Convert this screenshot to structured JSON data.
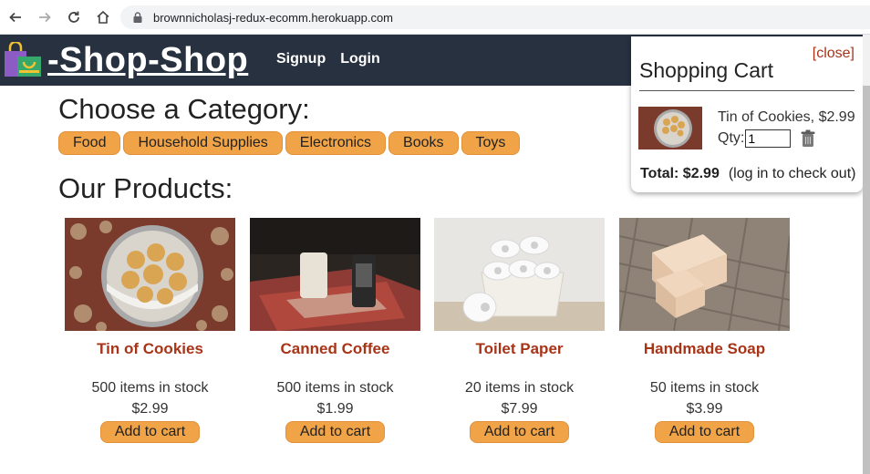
{
  "browser": {
    "url": "brownnicholasj-redux-ecomm.herokuapp.com"
  },
  "header": {
    "logo_text": "-Shop-Shop",
    "nav": [
      "Signup",
      "Login"
    ]
  },
  "main": {
    "category_heading": "Choose a Category:",
    "categories": [
      "Food",
      "Household Supplies",
      "Electronics",
      "Books",
      "Toys"
    ],
    "products_heading": "Our Products:",
    "products": [
      {
        "name": "Tin of Cookies",
        "stock": "500 items in stock",
        "price": "$2.99",
        "button": "Add to cart"
      },
      {
        "name": "Canned Coffee",
        "stock": "500 items in stock",
        "price": "$1.99",
        "button": "Add to cart"
      },
      {
        "name": "Toilet Paper",
        "stock": "20 items in stock",
        "price": "$7.99",
        "button": "Add to cart"
      },
      {
        "name": "Handmade Soap",
        "stock": "50 items in stock",
        "price": "$3.99",
        "button": "Add to cart"
      }
    ]
  },
  "cart": {
    "close_label": "[close]",
    "title": "Shopping Cart",
    "item": {
      "name_price": "Tin of Cookies, $2.99",
      "qty_label": "Qty:",
      "qty_value": "1"
    },
    "total_label": "Total: $2.99",
    "checkout_note": "(log in to check out)"
  },
  "colors": {
    "header_bg": "#27313f",
    "accent": "#f0a447",
    "link_red": "#a83418"
  }
}
